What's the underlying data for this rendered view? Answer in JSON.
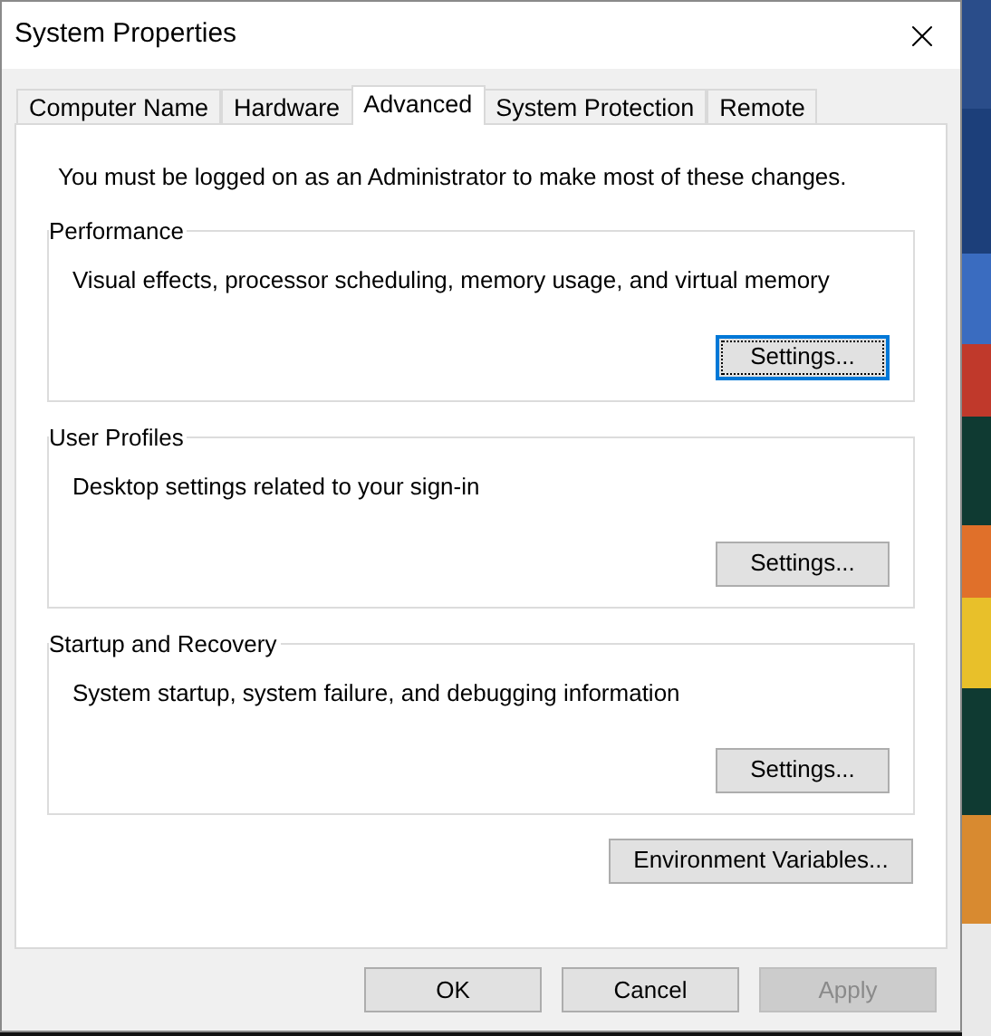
{
  "window": {
    "title": "System Properties"
  },
  "tabs": [
    {
      "label": "Computer Name",
      "selected": false
    },
    {
      "label": "Hardware",
      "selected": false
    },
    {
      "label": "Advanced",
      "selected": true
    },
    {
      "label": "System Protection",
      "selected": false
    },
    {
      "label": "Remote",
      "selected": false
    }
  ],
  "notice": "You must be logged on as an Administrator to make most of these changes.",
  "groups": [
    {
      "title": "Performance",
      "description": "Visual effects, processor scheduling, memory usage, and virtual memory",
      "button": {
        "label": "Settings...",
        "focused": true
      }
    },
    {
      "title": "User Profiles",
      "description": "Desktop settings related to your sign-in",
      "button": {
        "label": "Settings...",
        "focused": false
      }
    },
    {
      "title": "Startup and Recovery",
      "description": "System startup, system failure, and debugging information",
      "button": {
        "label": "Settings...",
        "focused": false
      }
    }
  ],
  "environment_button": {
    "label": "Environment Variables..."
  },
  "dialog_buttons": [
    {
      "label": "OK",
      "disabled": false
    },
    {
      "label": "Cancel",
      "disabled": false
    },
    {
      "label": "Apply",
      "disabled": true
    }
  ]
}
